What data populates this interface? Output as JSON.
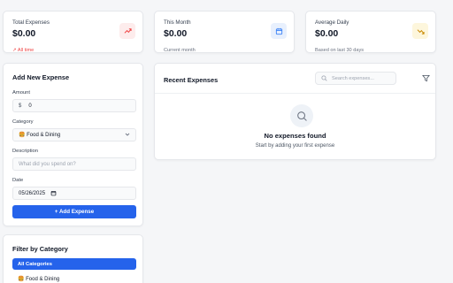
{
  "stats": [
    {
      "label": "Total Expenses",
      "value": "$0.00",
      "sub": "↗ All time",
      "icon": "trending-up-icon",
      "icon_color": "#ef4444",
      "icon_bg": "#fdecec"
    },
    {
      "label": "This Month",
      "value": "$0.00",
      "sub": "Current month",
      "icon": "calendar-icon",
      "icon_color": "#3b82f6",
      "icon_bg": "#e8f0fd"
    },
    {
      "label": "Average Daily",
      "value": "$0.00",
      "sub": "Based on last 30 days",
      "icon": "trending-down-icon",
      "icon_color": "#ca8a04",
      "icon_bg": "#fdf6dc"
    }
  ],
  "add_expense": {
    "title": "Add New Expense",
    "amount_label": "Amount",
    "amount_prefix": "$",
    "amount_value": "0",
    "category_label": "Category",
    "category_value": "🍔 Food & Dining",
    "description_label": "Description",
    "description_placeholder": "What did you spend on?",
    "date_label": "Date",
    "date_value": "05/26/2025",
    "submit_label": "+   Add Expense"
  },
  "recent": {
    "title": "Recent Expenses",
    "search_placeholder": "Search expenses...",
    "empty_title": "No expenses found",
    "empty_sub": "Start by adding your first expense"
  },
  "filter": {
    "title": "Filter by Category",
    "items": [
      {
        "label": "All Categories",
        "active": true
      },
      {
        "label": "🍔   Food & Dining",
        "active": false
      }
    ]
  },
  "colors": {
    "accent": "#2563eb"
  }
}
